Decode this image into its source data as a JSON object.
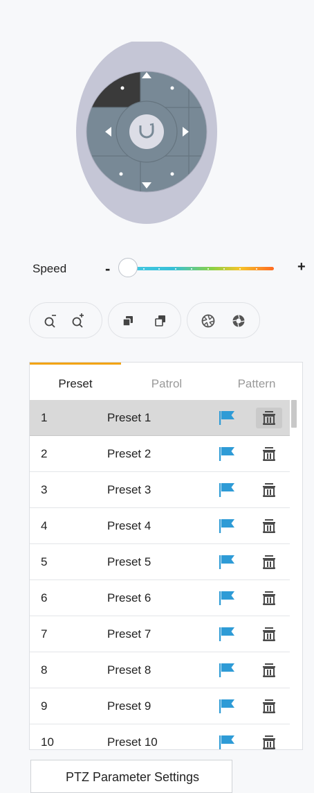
{
  "speed": {
    "label": "Speed",
    "minus": "-",
    "plus": "+",
    "value": 0.0
  },
  "tabs": [
    {
      "label": "Preset",
      "active": true
    },
    {
      "label": "Patrol",
      "active": false
    },
    {
      "label": "Pattern",
      "active": false
    }
  ],
  "presets": [
    {
      "no": "1",
      "name": "Preset 1",
      "selected": true
    },
    {
      "no": "2",
      "name": "Preset 2",
      "selected": false
    },
    {
      "no": "3",
      "name": "Preset 3",
      "selected": false
    },
    {
      "no": "4",
      "name": "Preset 4",
      "selected": false
    },
    {
      "no": "5",
      "name": "Preset 5",
      "selected": false
    },
    {
      "no": "6",
      "name": "Preset 6",
      "selected": false
    },
    {
      "no": "7",
      "name": "Preset 7",
      "selected": false
    },
    {
      "no": "8",
      "name": "Preset 8",
      "selected": false
    },
    {
      "no": "9",
      "name": "Preset 9",
      "selected": false
    },
    {
      "no": "10",
      "name": "Preset 10",
      "selected": false
    }
  ],
  "ptz_parameter_button": "PTZ Parameter Settings",
  "icons": {
    "flag": "flag-icon",
    "delete": "trash-icon",
    "zoom_out": "zoom-out-icon",
    "zoom_in": "zoom-in-icon",
    "focus_near": "focus-near-icon",
    "focus_far": "focus-far-icon",
    "iris_close": "iris-close-icon",
    "iris_open": "iris-open-icon",
    "auto_scan": "auto-rotate-icon"
  },
  "colors": {
    "accent": "#f2a30f",
    "flag": "#2e9bd6",
    "dial": "#788996",
    "dial_active": "#3a3a3a",
    "dial_ring": "#c5c6d6"
  }
}
